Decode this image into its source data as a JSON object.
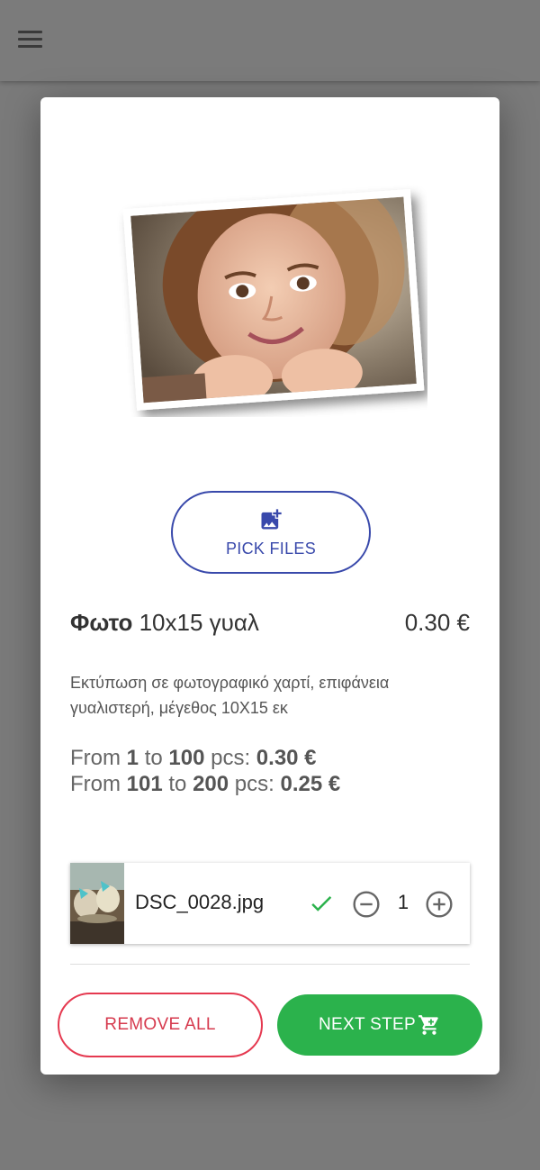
{
  "header": {
    "menu_icon": "hamburger-menu-icon"
  },
  "hero": {
    "image": "polaroid-photo-of-smiling-girl"
  },
  "pick_files": {
    "label": "PICK FILES",
    "icon": "add-photo-icon"
  },
  "product": {
    "title_bold": "Φωτο",
    "title_rest": " 10x15 γυαλ",
    "price": "0.30 €",
    "description": "Εκτύπωση σε φωτογραφικό χαρτί, επιφάνεια γυαλιστερή, μέγεθος 10X15 εκ"
  },
  "pricing": [
    {
      "from_label": "From ",
      "from": "1",
      "to_label": " to ",
      "to": "100",
      "pcs_label": " pcs: ",
      "price": "0.30 €"
    },
    {
      "from_label": "From ",
      "from": "101",
      "to_label": " to ",
      "to": "200",
      "pcs_label": " pcs: ",
      "price": "0.25 €"
    }
  ],
  "files": [
    {
      "name": "DSC_0028.jpg",
      "quantity": "1",
      "status_icon": "check-icon"
    }
  ],
  "actions": {
    "remove_all": "REMOVE ALL",
    "next_step": "NEXT STEP",
    "next_icon": "shopping-cart-icon"
  },
  "colors": {
    "primary": "#3949ab",
    "danger": "#e53950",
    "success": "#2bb24c"
  }
}
